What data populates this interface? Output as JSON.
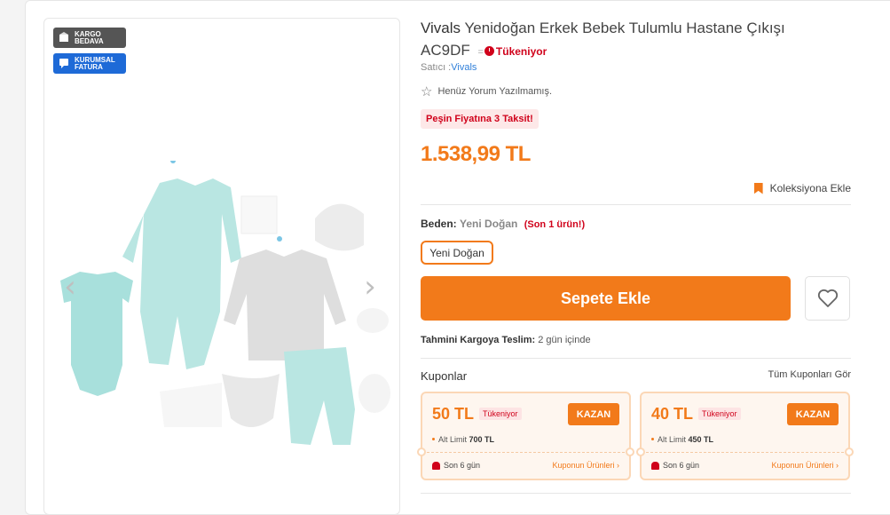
{
  "badges": {
    "cargo": "KARGO BEDAVA",
    "invoice": "KURUMSAL FATURA"
  },
  "gallery": {
    "prev_icon": "chevron-left-icon",
    "next_icon": "chevron-right-icon"
  },
  "product": {
    "brand": "Vivals",
    "name": "Yenidoğan Erkek Bebek Tulumlu Hastane Çıkışı AC9DF",
    "stock_status": "Tükeniyor",
    "seller_label": "Satıcı :",
    "seller_name": "Vivals",
    "reviews_text": "Henüz Yorum Yazılmamış.",
    "promo": "Peşin Fiyatına 3 Taksit!",
    "price": "1.538,99 TL",
    "collection_label": "Koleksiyona Ekle"
  },
  "size": {
    "label": "Beden:",
    "value": "Yeni Doğan",
    "warning": "(Son 1 ürün!)",
    "option": "Yeni Doğan"
  },
  "actions": {
    "add_to_cart": "Sepete Ekle",
    "favorite_icon": "heart-icon"
  },
  "delivery": {
    "label": "Tahmini Kargoya Teslim:",
    "value": "2 gün içinde"
  },
  "coupons": {
    "title": "Kuponlar",
    "see_all": "Tüm Kuponları Gör",
    "items": [
      {
        "amount": "50 TL",
        "tag": "Tükeniyor",
        "button": "KAZAN",
        "limit_label": "Alt Limit",
        "limit_value": "700 TL",
        "days": "Son 6 gün",
        "products_link": "Kuponun Ürünleri ›"
      },
      {
        "amount": "40 TL",
        "tag": "Tükeniyor",
        "button": "KAZAN",
        "limit_label": "Alt Limit",
        "limit_value": "450 TL",
        "days": "Son 6 gün",
        "products_link": "Kuponun Ürünleri ›"
      }
    ]
  },
  "colors": {
    "accent": "#f27a1a",
    "danger": "#d0021b",
    "link": "#2f7fd9"
  }
}
